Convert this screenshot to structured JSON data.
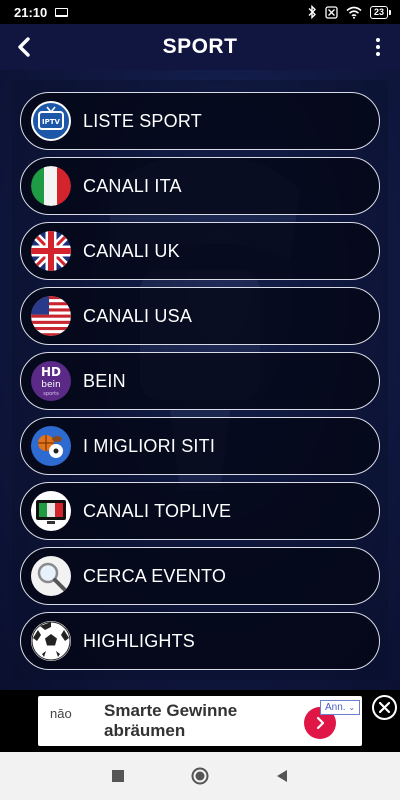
{
  "status_bar": {
    "time": "21:10",
    "battery": "23",
    "icons": [
      "laptop-icon",
      "bluetooth-icon",
      "sim-off-icon",
      "wifi-icon",
      "battery-icon"
    ]
  },
  "header": {
    "title": "SPORT",
    "back_icon": "chevron-left-icon",
    "menu_icon": "more-vertical-icon"
  },
  "menu": {
    "items": [
      {
        "label": "LISTE SPORT",
        "icon": "iptv-tv-icon"
      },
      {
        "label": "CANALI ITA",
        "icon": "italy-flag-icon"
      },
      {
        "label": "CANALI UK",
        "icon": "uk-flag-icon"
      },
      {
        "label": "CANALI USA",
        "icon": "usa-flag-icon"
      },
      {
        "label": "BEIN",
        "icon": "bein-sports-icon"
      },
      {
        "label": "I MIGLIORI SITI",
        "icon": "sports-balls-icon"
      },
      {
        "label": "CANALI TOPLIVE",
        "icon": "toplive-tv-icon"
      },
      {
        "label": "CERCA EVENTO",
        "icon": "search-magnifier-icon"
      },
      {
        "label": "HIGHLIGHTS",
        "icon": "soccer-ball-icon"
      }
    ]
  },
  "ad": {
    "brand": "nāo",
    "text": "Smarte Gewinne abräumen",
    "tag": "Ann.",
    "accent": "#e01646"
  },
  "colors": {
    "background": "#0c1030",
    "header": "#101640",
    "item_border": "#d9dbe6"
  },
  "navbar": {
    "buttons": [
      "recents-square-icon",
      "home-circle-icon",
      "back-triangle-icon"
    ]
  }
}
